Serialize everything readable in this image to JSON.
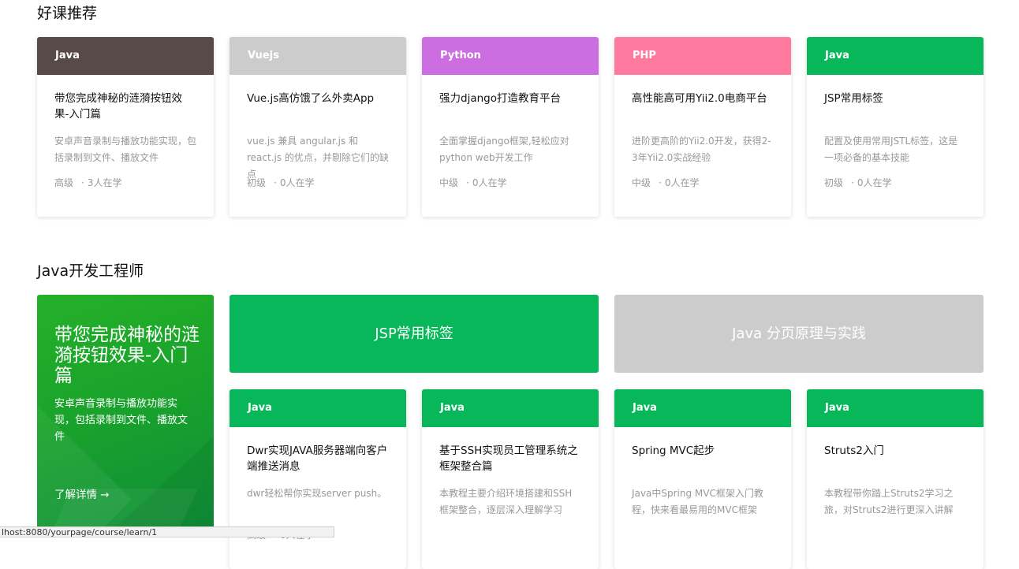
{
  "section1": {
    "title": "好课推荐",
    "cards": [
      {
        "tag": "Java",
        "color": "#574a47",
        "title": "带您完成神秘的涟漪按钮效果-入门篇",
        "desc": "安卓声音录制与播放功能实现，包括录制到文件、播放文件",
        "level": "高级",
        "students": "3人在学"
      },
      {
        "tag": "Vuejs",
        "color": "#cccccc",
        "title": "Vue.js高仿饿了么外卖App",
        "desc": "vue.js 兼具 angular.js 和 react.js 的优点，并剔除它们的缺点",
        "level": "初级",
        "students": "0人在学"
      },
      {
        "tag": "Python",
        "color": "#cc6ee2",
        "title": "强力django打造教育平台",
        "desc": "全面掌握django框架,轻松应对python web开发工作",
        "level": "中级",
        "students": "0人在学"
      },
      {
        "tag": "PHP",
        "color": "#ff7a9e",
        "title": "高性能高可用Yii2.0电商平台",
        "desc": "进阶更高阶的Yii2.0开发，获得2-3年Yii2.0实战经验",
        "level": "中级",
        "students": "0人在学"
      },
      {
        "tag": "Java",
        "color": "#07b75a",
        "title": "JSP常用标签",
        "desc": "配置及使用常用JSTL标签，这是一项必备的基本技能",
        "level": "初级",
        "students": "0人在学"
      }
    ]
  },
  "section2": {
    "title": "Java开发工程师",
    "feature": {
      "title": "带您完成神秘的涟漪按钮效果-入门篇",
      "desc": "安卓声音录制与播放功能实现，包括录制到文件、播放文件",
      "link": "了解详情 →"
    },
    "banners": [
      {
        "label": "JSP常用标签",
        "color": "#07b75a"
      },
      {
        "label": "Java 分页原理与实践",
        "color": "#cccccc"
      }
    ],
    "cards": [
      {
        "tag": "Java",
        "color": "#07b75a",
        "title": "Dwr实现JAVA服务器端向客户端推送消息",
        "desc": "dwr轻松帮你实现server push。",
        "level": "高级",
        "students": "0人在学"
      },
      {
        "tag": "Java",
        "color": "#07b75a",
        "title": "基于SSH实现员工管理系统之框架整合篇",
        "desc": "本教程主要介绍环境搭建和SSH框架整合，逐层深入理解学习",
        "level": "",
        "students": ""
      },
      {
        "tag": "Java",
        "color": "#07b75a",
        "title": "Spring MVC起步",
        "desc": "Java中Spring MVC框架入门教程，快来看最易用的MVC框架",
        "level": "",
        "students": ""
      },
      {
        "tag": "Java",
        "color": "#07b75a",
        "title": "Struts2入门",
        "desc": "本教程带你踏上Struts2学习之旅，对Struts2进行更深入讲解",
        "level": "",
        "students": ""
      }
    ]
  },
  "statusbar": {
    "url": "lhost:8080/yourpage/course/learn/1"
  },
  "meta_dot": "·"
}
